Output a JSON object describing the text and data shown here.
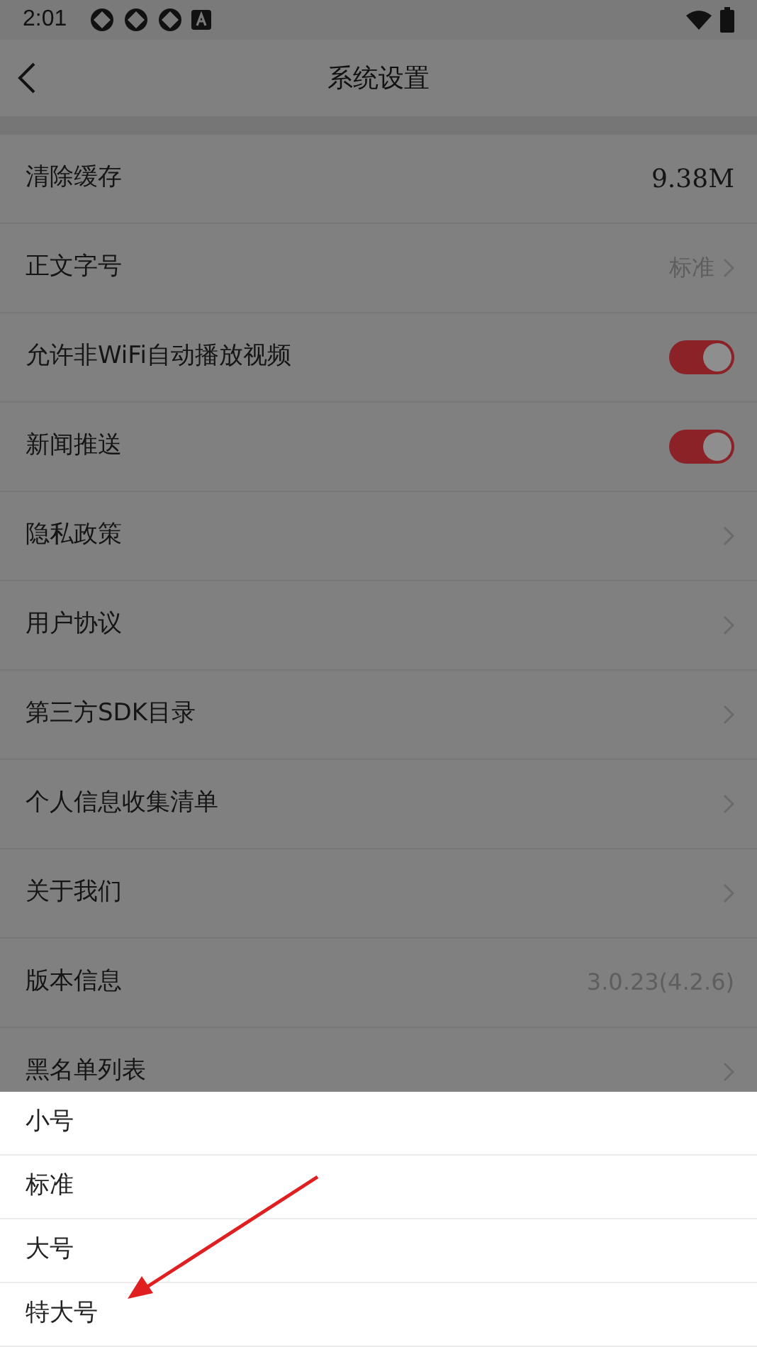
{
  "status_bar": {
    "time": "2:01"
  },
  "header": {
    "title": "系统设置"
  },
  "settings": [
    {
      "kind": "value",
      "label": "清除缓存",
      "value": "9.38M"
    },
    {
      "kind": "link",
      "label": "正文字号",
      "value": "标准"
    },
    {
      "kind": "toggle",
      "label": "允许非WiFi自动播放视频",
      "on": true
    },
    {
      "kind": "toggle",
      "label": "新闻推送",
      "on": true
    },
    {
      "kind": "link",
      "label": "隐私政策"
    },
    {
      "kind": "link",
      "label": "用户协议"
    },
    {
      "kind": "link",
      "label": "第三方SDK目录"
    },
    {
      "kind": "link",
      "label": "个人信息收集清单"
    },
    {
      "kind": "link",
      "label": "关于我们"
    },
    {
      "kind": "info",
      "label": "版本信息",
      "value": "3.0.23(4.2.6)"
    },
    {
      "kind": "link",
      "label": "黑名单列表"
    }
  ],
  "font_size_sheet": {
    "options": [
      {
        "label": "小号"
      },
      {
        "label": "标准"
      },
      {
        "label": "大号"
      },
      {
        "label": "特大号"
      }
    ]
  }
}
